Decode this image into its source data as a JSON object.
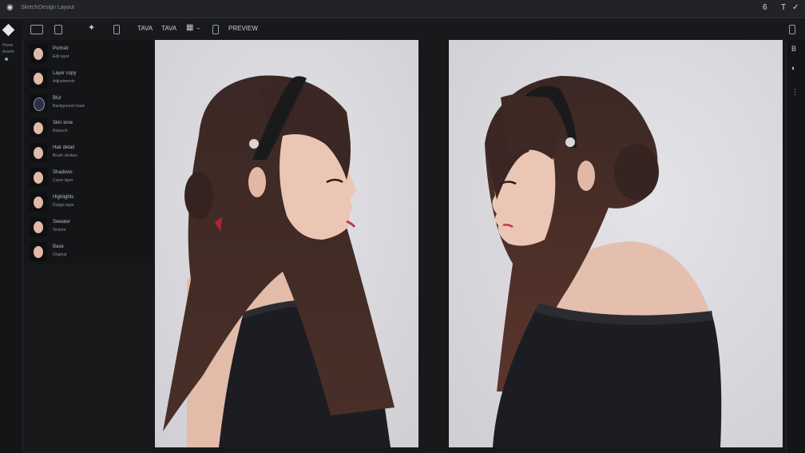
{
  "titlebar": {
    "menu": [
      "Sketch",
      "Design",
      "Layout"
    ],
    "right_icons": [
      "6",
      "T",
      "✓"
    ]
  },
  "toolbar": {
    "tabs": [
      "TAVA",
      "TAVA"
    ],
    "preview_label": "PREVIEW"
  },
  "leftrail": {
    "labels": [
      "Home",
      "Assets"
    ]
  },
  "layers": [
    {
      "title": "Portrait",
      "sub": "Edit layer",
      "dark": false
    },
    {
      "title": "Layer copy",
      "sub": "Adjustments",
      "dark": false
    },
    {
      "title": "Blur",
      "sub": "Background mask",
      "dark": true
    },
    {
      "title": "Skin tone",
      "sub": "Retouch",
      "dark": false
    },
    {
      "title": "Hair detail",
      "sub": "Brush strokes",
      "dark": false
    },
    {
      "title": "Shadows",
      "sub": "Curve layer",
      "dark": false
    },
    {
      "title": "Highlights",
      "sub": "Dodge layer",
      "dark": false
    },
    {
      "title": "Sweater",
      "sub": "Texture",
      "dark": false
    },
    {
      "title": "Base",
      "sub": "Original",
      "dark": false
    }
  ],
  "rightpanel": {
    "icons": [
      "B",
      "◐",
      "⋮"
    ]
  },
  "colors": {
    "hair": "#3a2622",
    "sweater": "#1c1d22",
    "skin": "#e8c3b3",
    "canvas_bg": "#dcdbe0"
  }
}
